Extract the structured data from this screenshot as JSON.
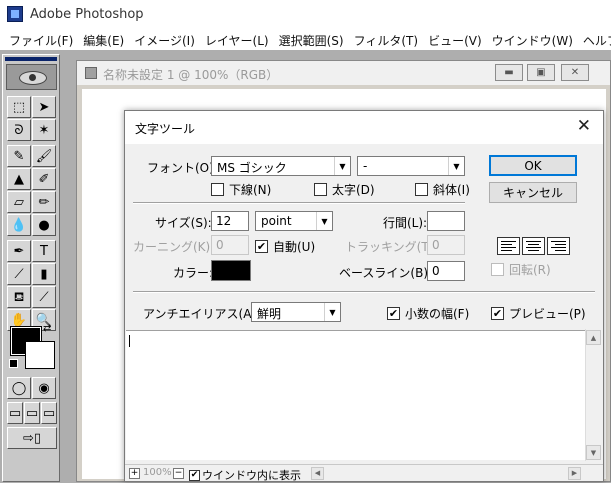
{
  "app": {
    "title": "Adobe Photoshop"
  },
  "menu": [
    "ファイル(F)",
    "編集(E)",
    "イメージ(I)",
    "レイヤー(L)",
    "選択範囲(S)",
    "フィルタ(T)",
    "ビュー(V)",
    "ウインドウ(W)",
    "ヘルプ(H)"
  ],
  "document": {
    "title": "名称未設定 1 @ 100%（RGB）"
  },
  "dialog": {
    "title": "文字ツール",
    "font_label": "フォント(O):",
    "font_value": "MS ゴシック",
    "style_value": "-",
    "underline_label": "下線(N)",
    "bold_label": "太字(D)",
    "italic_label": "斜体(I)",
    "ok_label": "OK",
    "cancel_label": "キャンセル",
    "size_label": "サイズ(S):",
    "size_value": "12",
    "unit_value": "point",
    "leading_label": "行間(L):",
    "leading_value": "",
    "kerning_label": "カーニング(K):",
    "kerning_value": "0",
    "auto_label": "自動(U)",
    "tracking_label": "トラッキング(T):",
    "tracking_value": "0",
    "color_label": "カラー:",
    "color_value": "#000000",
    "baseline_label": "ベースライン(B):",
    "baseline_value": "0",
    "rotate_label": "回転(R)",
    "antialias_label": "アンチエイリアス(A):",
    "antialias_value": "鮮明",
    "fractional_label": "小数の幅(F)",
    "preview_label": "プレビュー(P)",
    "zoom_value": "100%",
    "fit_window_label": "ウインドウ内に表示"
  }
}
